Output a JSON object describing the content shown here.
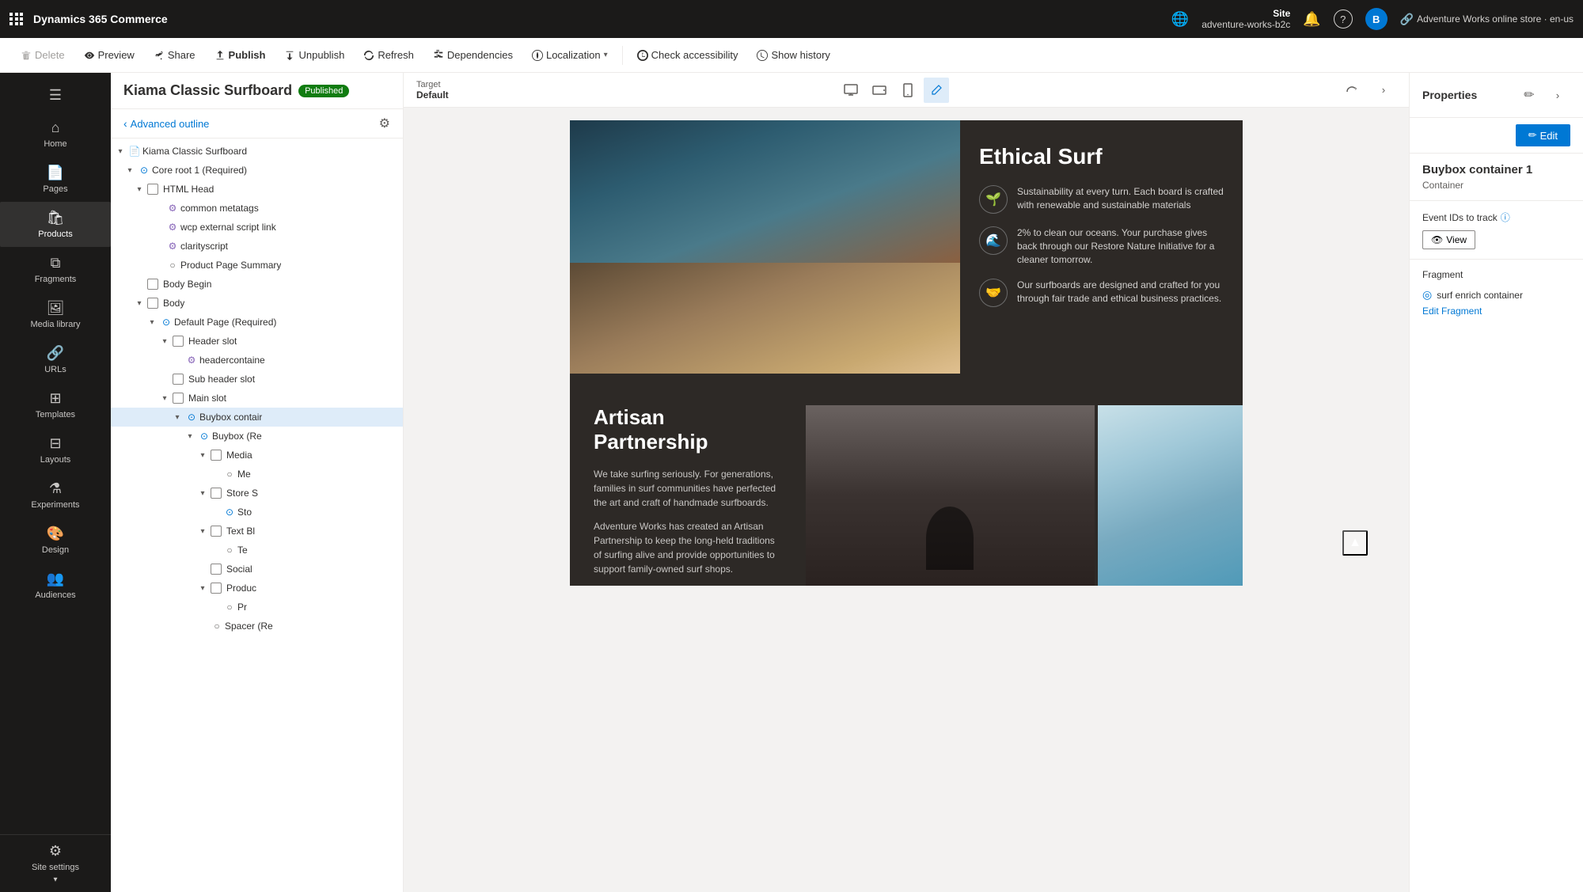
{
  "app": {
    "name": "Dynamics 365 Commerce"
  },
  "topbar": {
    "waffle_label": "waffle",
    "site_label": "Site",
    "site_name": "adventure-works-b2c",
    "store_label": "Adventure Works online store · en-us",
    "bell_icon": "🔔",
    "help_icon": "?",
    "user_icon": "B"
  },
  "toolbar": {
    "delete_label": "Delete",
    "preview_label": "Preview",
    "share_label": "Share",
    "publish_label": "Publish",
    "unpublish_label": "Unpublish",
    "refresh_label": "Refresh",
    "dependencies_label": "Dependencies",
    "localization_label": "Localization",
    "check_accessibility_label": "Check accessibility",
    "show_history_label": "Show history"
  },
  "page": {
    "title": "Kiama Classic Surfboard",
    "status": "Published",
    "target_label": "Target",
    "target_value": "Default",
    "edit_label": "Edit"
  },
  "outline": {
    "back_label": "Advanced outline",
    "settings_icon": "⚙",
    "tree": [
      {
        "id": "kiama",
        "label": "Kiama Classic Surfboard",
        "depth": 0,
        "expand": true,
        "icon": "page",
        "type": "page"
      },
      {
        "id": "core-root",
        "label": "Core root 1 (Required)",
        "depth": 1,
        "expand": true,
        "icon": "required",
        "type": "required"
      },
      {
        "id": "html-head",
        "label": "HTML Head",
        "depth": 2,
        "expand": true,
        "icon": "checkbox",
        "type": "checkbox"
      },
      {
        "id": "common-meta",
        "label": "common metatags",
        "depth": 3,
        "icon": "meta",
        "type": "meta"
      },
      {
        "id": "wcp-script",
        "label": "wcp external script link",
        "depth": 3,
        "icon": "meta",
        "type": "meta"
      },
      {
        "id": "clarity",
        "label": "clarityscript",
        "depth": 3,
        "icon": "meta",
        "type": "meta"
      },
      {
        "id": "product-page-summary",
        "label": "Product Page Summary",
        "depth": 3,
        "icon": "circle",
        "type": "circle"
      },
      {
        "id": "body-begin",
        "label": "Body Begin",
        "depth": 2,
        "icon": "checkbox",
        "type": "checkbox"
      },
      {
        "id": "body",
        "label": "Body",
        "depth": 2,
        "expand": true,
        "icon": "checkbox",
        "type": "checkbox"
      },
      {
        "id": "default-page",
        "label": "Default Page (Required)",
        "depth": 3,
        "expand": true,
        "icon": "required",
        "type": "required"
      },
      {
        "id": "header-slot",
        "label": "Header slot",
        "depth": 4,
        "expand": true,
        "icon": "checkbox",
        "type": "checkbox"
      },
      {
        "id": "headercontaine",
        "label": "headercontaine",
        "depth": 5,
        "icon": "meta",
        "type": "meta"
      },
      {
        "id": "sub-header-slot",
        "label": "Sub header slot",
        "depth": 4,
        "icon": "checkbox",
        "type": "checkbox"
      },
      {
        "id": "main-slot",
        "label": "Main slot",
        "depth": 4,
        "expand": true,
        "icon": "checkbox",
        "type": "checkbox"
      },
      {
        "id": "buybox-container",
        "label": "Buybox contair",
        "depth": 5,
        "expand": true,
        "icon": "required",
        "type": "required",
        "selected": true
      },
      {
        "id": "buybox-re",
        "label": "Buybox (Re",
        "depth": 6,
        "expand": true,
        "icon": "required",
        "type": "required"
      },
      {
        "id": "media",
        "label": "Media",
        "depth": 7,
        "expand": true,
        "icon": "checkbox",
        "type": "checkbox"
      },
      {
        "id": "media-m",
        "label": "Me",
        "depth": 8,
        "icon": "circle",
        "type": "circle"
      },
      {
        "id": "store-s",
        "label": "Store S",
        "depth": 7,
        "expand": true,
        "icon": "checkbox",
        "type": "checkbox"
      },
      {
        "id": "store-st",
        "label": "Sto",
        "depth": 8,
        "icon": "required",
        "type": "required"
      },
      {
        "id": "text-bl",
        "label": "Text Bl",
        "depth": 7,
        "expand": true,
        "icon": "checkbox",
        "type": "checkbox"
      },
      {
        "id": "text-te",
        "label": "Te",
        "depth": 8,
        "icon": "circle",
        "type": "circle"
      },
      {
        "id": "social",
        "label": "Social",
        "depth": 7,
        "icon": "checkbox",
        "type": "checkbox"
      },
      {
        "id": "produc",
        "label": "Produc",
        "depth": 7,
        "expand": true,
        "icon": "checkbox",
        "type": "checkbox"
      },
      {
        "id": "produc-p",
        "label": "Pr",
        "depth": 8,
        "icon": "circle",
        "type": "circle"
      },
      {
        "id": "spacer",
        "label": "Spacer (Re",
        "depth": 7,
        "icon": "circle",
        "type": "circle"
      }
    ]
  },
  "canvas": {
    "device_icons": [
      "desktop",
      "tablet-landscape",
      "tablet",
      "pencil"
    ],
    "ethical_surf": {
      "title": "Ethical Surf",
      "items": [
        {
          "icon": "🌱",
          "text": "Sustainability at every turn. Each board is crafted with renewable and sustainable materials"
        },
        {
          "icon": "🌊",
          "text": "2% to clean our oceans. Your purchase gives back through our Restore Nature Initiative for a cleaner tomorrow."
        },
        {
          "icon": "🤝",
          "text": "Our surfboards are designed and crafted for you through fair trade and ethical business practices."
        }
      ]
    },
    "artisan": {
      "title": "Artisan Partnership",
      "desc1": "We take surfing seriously. For generations, families in surf communities have perfected the art and craft of handmade surfboards.",
      "desc2": "Adventure Works has created an Artisan Partnership to keep the long-held traditions of surfing alive and provide opportunities to support family-owned surf shops."
    }
  },
  "properties": {
    "panel_title": "Properties",
    "container_name": "Buybox container 1",
    "container_type": "Container",
    "event_ids_label": "Event IDs to track",
    "info_icon": "ⓘ",
    "view_label": "View",
    "fragment_label": "Fragment",
    "fragment_name": "surf enrich container",
    "edit_fragment_label": "Edit Fragment"
  }
}
